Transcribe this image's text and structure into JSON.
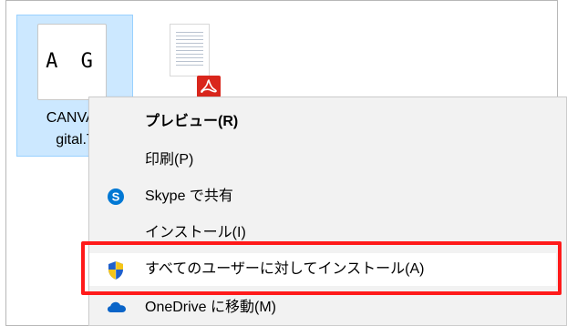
{
  "files": {
    "font_file": {
      "preview_text": "A G",
      "name_line1": "CANVAS",
      "name_line2": "gital.T"
    },
    "pdf_file": {
      "badge_icon": "acrobat-icon"
    }
  },
  "context_menu": {
    "items": [
      {
        "label": "プレビュー(R)",
        "icon": "",
        "bold": true
      },
      {
        "label": "印刷(P)",
        "icon": ""
      },
      {
        "label": "Skype で共有",
        "icon": "skype-icon"
      },
      {
        "label": "インストール(I)",
        "icon": ""
      },
      {
        "label": "すべてのユーザーに対してインストール(A)",
        "icon": "uac-shield-icon"
      },
      {
        "label": "OneDrive に移動(M)",
        "icon": "onedrive-cloud-icon"
      }
    ]
  },
  "colors": {
    "selection_bg": "#cce8ff",
    "menu_bg": "#f2f2f2",
    "highlight": "#ff1a1a",
    "pdf_red": "#d9261c",
    "skype_blue": "#0078d4"
  }
}
